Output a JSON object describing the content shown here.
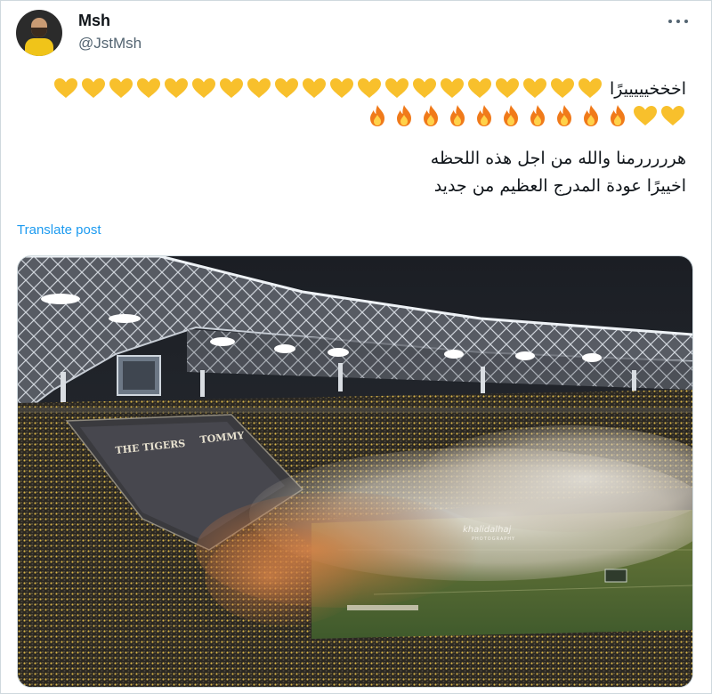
{
  "author": {
    "display_name": "Msh",
    "handle": "@JstMsh",
    "avatar_icon": "profile-photo"
  },
  "post": {
    "line1_text": "اخخخيييييرًا",
    "line1_hearts": 20,
    "line2_hearts": 2,
    "line2_fires": 10,
    "line3": "هرررررمنا والله من اجل هذه اللحظه",
    "line4": "اخييرًا عودة المدرج العظيم من جديد",
    "heart_color": "#f8c02c",
    "fire_color": "#f07a1a"
  },
  "translate_label": "Translate post",
  "media": {
    "watermark_name": "khalidalhaj",
    "watermark_sub": "PHOTOGRAPHY",
    "tifo_text_left": "THE TIGERS",
    "tifo_text_right": "TOMMY"
  },
  "colors": {
    "link": "#1d9bf0",
    "muted": "#536471"
  }
}
